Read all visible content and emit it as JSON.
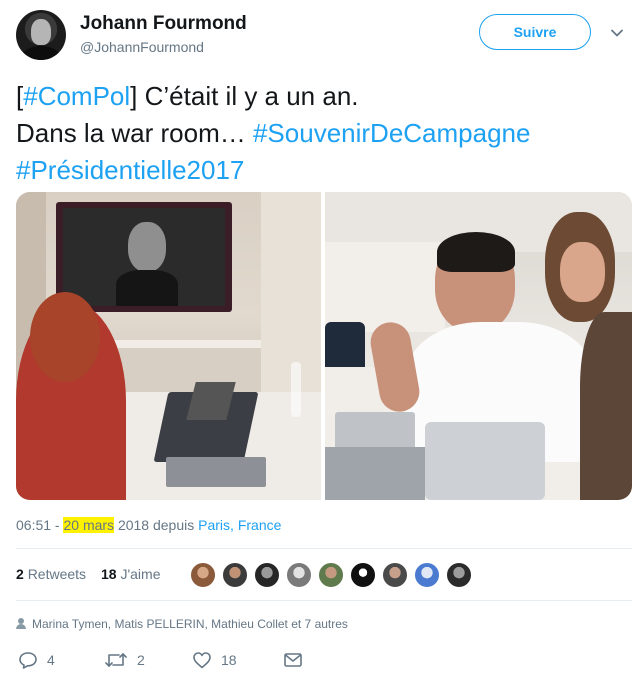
{
  "user": {
    "name": "Johann Fourmond",
    "handle": "@JohannFourmond",
    "follow_label": "Suivre"
  },
  "tweet": {
    "line1_pre": "[",
    "line1_tag": "#ComPol",
    "line1_post": "] C’était il y a un an.",
    "line2_pre": "Dans la war room… ",
    "line2_tag": "#SouvenirDeCampagne",
    "line3_tag": "#Présidentielle2017"
  },
  "meta": {
    "time": "06:51 - ",
    "date_highlight": "20 mars",
    "year_via": " 2018 depuis ",
    "location": "Paris, France"
  },
  "stats": {
    "retweets_count": "2",
    "retweets_label": "Retweets",
    "likes_count": "18",
    "likes_label": "J'aime"
  },
  "liked_by": "Marina Tymen, Matis PELLERIN, Mathieu Collet et 7 autres",
  "actions": {
    "replies": "4",
    "retweets": "2",
    "likes": "18"
  },
  "colors": {
    "accent": "#1da1f2",
    "text": "#14171a",
    "secondary": "#657786",
    "highlight": "#fff200"
  },
  "icons": [
    "chevron-down-icon",
    "reply-icon",
    "retweet-icon",
    "heart-icon",
    "mail-icon",
    "person-icon"
  ]
}
